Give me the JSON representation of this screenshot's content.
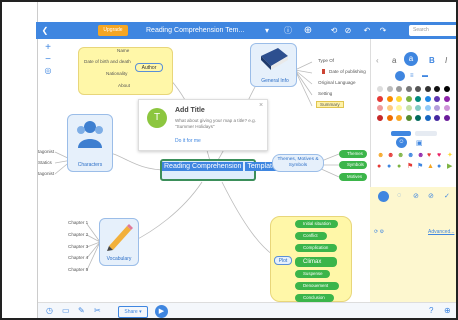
{
  "toolbar": {
    "upgrade": "Upgrade",
    "title": "Reading Comprehension Tem...",
    "search_placeholder": "Search",
    "mode": "Present"
  },
  "central": {
    "line1": "Reading Comprehension",
    "line2": "Template (Fiction)"
  },
  "author": {
    "label": "Author",
    "items": [
      "Name",
      "Date of birth and death",
      "Nationality",
      "About"
    ]
  },
  "general": {
    "label": "General Info",
    "items": [
      "Type Of",
      "Date of publishing",
      "Original Language",
      "Setting",
      "Summary"
    ]
  },
  "characters": {
    "label": "Characters",
    "items": [
      "tagonist",
      "Statics",
      "tagonist"
    ]
  },
  "themes": {
    "label": "Themes, Motives & Symbols",
    "items": [
      "Themes",
      "Symbols",
      "Motives"
    ]
  },
  "vocabulary": {
    "label": "Vocabulary",
    "items": [
      "Chapter 1",
      "Chapter 2",
      "Chapter 3",
      "Chapter 4",
      "Chapter 5"
    ]
  },
  "plot": {
    "label": "Plot",
    "items": [
      "Initial situation",
      "Conflict",
      "Complication",
      "Climax",
      "Suspense",
      "Denouement",
      "Conclusion"
    ]
  },
  "popup": {
    "title": "Add Title",
    "desc": "What about giving your map a title? e.g. \"Summer Holidays\"",
    "link": "Do it for me"
  },
  "bottombar": {
    "share": "Share"
  },
  "colors": {
    "accent": "#3f86e0",
    "author_yellow": "#fff7a8",
    "plot_green": "#3bb54a"
  }
}
